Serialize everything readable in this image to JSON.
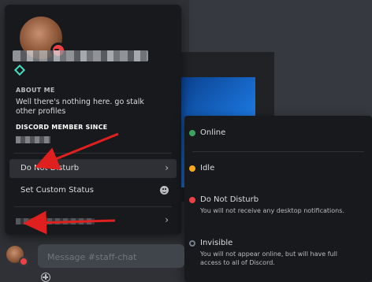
{
  "profile": {
    "about_me_title": "ABOUT ME",
    "about_me_text": "Well there's nothing here. go stalk other profiles",
    "member_since_title": "DISCORD MEMBER SINCE",
    "menu": {
      "status_label": "Do Not Disturb",
      "custom_status_label": "Set Custom Status"
    }
  },
  "status_menu": {
    "options": [
      {
        "label": "Online",
        "desc": "",
        "color": "#3ba55d"
      },
      {
        "label": "Idle",
        "desc": "",
        "color": "#faa81a"
      },
      {
        "label": "Do Not Disturb",
        "desc": "You will not receive any desktop notifications.",
        "color": "#ed4245"
      },
      {
        "label": "Invisible",
        "desc": "You will not appear online, but will have full access to all of Discord.",
        "color": "#747f8d"
      }
    ]
  },
  "chat": {
    "placeholder": "Message #staff-chat"
  },
  "colors": {
    "dnd": "#ed4245",
    "online": "#3ba55d",
    "idle": "#faa81a",
    "invisible": "#747f8d",
    "annotation": "#e0201f"
  },
  "icons": [
    "avatar",
    "dnd-status-icon",
    "hypesquad-badge-icon",
    "chevron-right-icon",
    "emoji-icon",
    "plus-circle-icon",
    "annotation-arrow"
  ]
}
